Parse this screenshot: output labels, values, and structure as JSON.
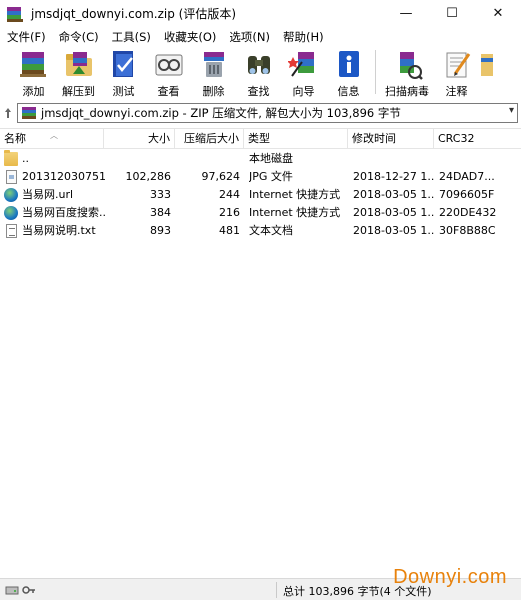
{
  "window": {
    "title": "jmsdjqt_downyi.com.zip (评估版本)"
  },
  "win_controls": {
    "minimize": "—",
    "maximize": "☐",
    "close": "✕"
  },
  "menu": [
    "文件(F)",
    "命令(C)",
    "工具(S)",
    "收藏夹(O)",
    "选项(N)",
    "帮助(H)"
  ],
  "toolbar": [
    {
      "label": "添加",
      "icon": "add-icon"
    },
    {
      "label": "解压到",
      "icon": "extract-to-icon"
    },
    {
      "label": "测试",
      "icon": "test-icon"
    },
    {
      "label": "查看",
      "icon": "view-icon"
    },
    {
      "label": "删除",
      "icon": "delete-icon"
    },
    {
      "label": "查找",
      "icon": "find-icon"
    },
    {
      "label": "向导",
      "icon": "wizard-icon"
    },
    {
      "label": "信息",
      "icon": "info-icon"
    },
    {
      "label": "扫描病毒",
      "icon": "virus-scan-icon"
    },
    {
      "label": "注释",
      "icon": "comment-icon"
    }
  ],
  "address": {
    "text": "jmsdjqt_downyi.com.zip - ZIP 压缩文件, 解包大小为 103,896 字节"
  },
  "columns": {
    "name": "名称",
    "size": "大小",
    "packed": "压缩后大小",
    "type": "类型",
    "modified": "修改时间",
    "crc": "CRC32"
  },
  "files": [
    {
      "name": "..",
      "size": "",
      "packed": "",
      "type": "本地磁盘",
      "modified": "",
      "crc": "",
      "icon": "folder-icon"
    },
    {
      "name": "201312030751...",
      "size": "102,286",
      "packed": "97,624",
      "type": "JPG 文件",
      "modified": "2018-12-27 1...",
      "crc": "24DAD7...",
      "icon": "jpg-file-icon"
    },
    {
      "name": "当易网.url",
      "size": "333",
      "packed": "244",
      "type": "Internet 快捷方式",
      "modified": "2018-03-05 1...",
      "crc": "7096605F",
      "icon": "url-file-icon"
    },
    {
      "name": "当易网百度搜索...",
      "size": "384",
      "packed": "216",
      "type": "Internet 快捷方式",
      "modified": "2018-03-05 1...",
      "crc": "220DE432",
      "icon": "url-file-icon"
    },
    {
      "name": "当易网说明.txt",
      "size": "893",
      "packed": "481",
      "type": "文本文档",
      "modified": "2018-03-05 1...",
      "crc": "30F8B88C",
      "icon": "text-file-icon"
    }
  ],
  "status": {
    "text": "总计 103,896 字节(4 个文件)"
  },
  "watermark": "Downyi.com"
}
